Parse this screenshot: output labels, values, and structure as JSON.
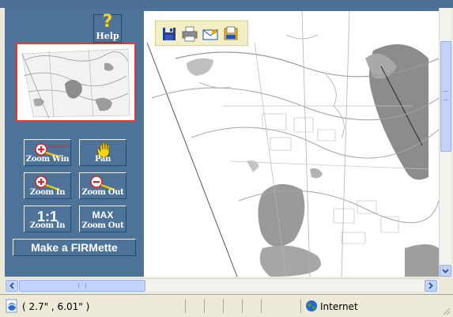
{
  "left_panel": {
    "help_label": "Help",
    "help_glyph": "?",
    "tools": {
      "zoom_win": "Zoom Win",
      "pan": "Pan",
      "zoom_in": "Zoom In",
      "zoom_out": "Zoom Out",
      "one_to_one_big": "1:1",
      "one_to_one_label": "Zoom In",
      "max_big": "MAX",
      "max_label": "Zoom Out"
    },
    "firmette_label": "Make a FIRMette"
  },
  "map_toolbar": {
    "icons": [
      "save-icon",
      "print-icon",
      "email-icon",
      "export-icon"
    ]
  },
  "status_bar": {
    "coordinates": "( 2.7\" , 6.01\" )",
    "zone": "Internet"
  },
  "colors": {
    "panel": "#4e7398",
    "overview_border": "#e23a2a",
    "help_glyph": "#f6d31d",
    "scroll_thumb": "#c1d3fb"
  }
}
